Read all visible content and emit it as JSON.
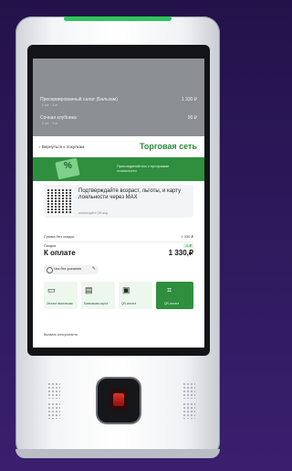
{
  "kiosk": {
    "items": [
      {
        "name": "Пресервированный салат (Бальзам)",
        "sub": "1 шт. · 1 кг",
        "price": "1 330 ₽"
      },
      {
        "name": "Сочная клубника",
        "sub": "1 шт. · 2 кг",
        "price": "90 ₽"
      }
    ],
    "header": {
      "back_label": "Вернуться к покупкам",
      "brand": "Торговая сеть"
    },
    "banner": {
      "percent": "%",
      "text": "Присоединяйтесь к программе лояльности"
    },
    "qr": {
      "title": "Подтверждайте возраст, льготы, и карту лояльности через MAX",
      "subtitle": "используйте QR-код"
    },
    "summary": {
      "rows": [
        {
          "label": "Сумма без скидки",
          "value": "1 330,₽"
        },
        {
          "label": "Скидка",
          "value": "-0,₽"
        }
      ],
      "total_label": "К оплате",
      "total_value": "1 330,₽"
    },
    "receipt_toggle": "Чек без указания",
    "pay_options": [
      {
        "label": "Оплата наличными",
        "icon": "cash-icon"
      },
      {
        "label": "Банковская карта",
        "icon": "card-icon"
      },
      {
        "label": "QR-оплата",
        "icon": "qr-icon"
      }
    ],
    "help_link": "Вызвать консультанта",
    "colors": {
      "accent": "#2f8f3e",
      "strip": "#2ec55a",
      "background": "#2a1758"
    }
  }
}
